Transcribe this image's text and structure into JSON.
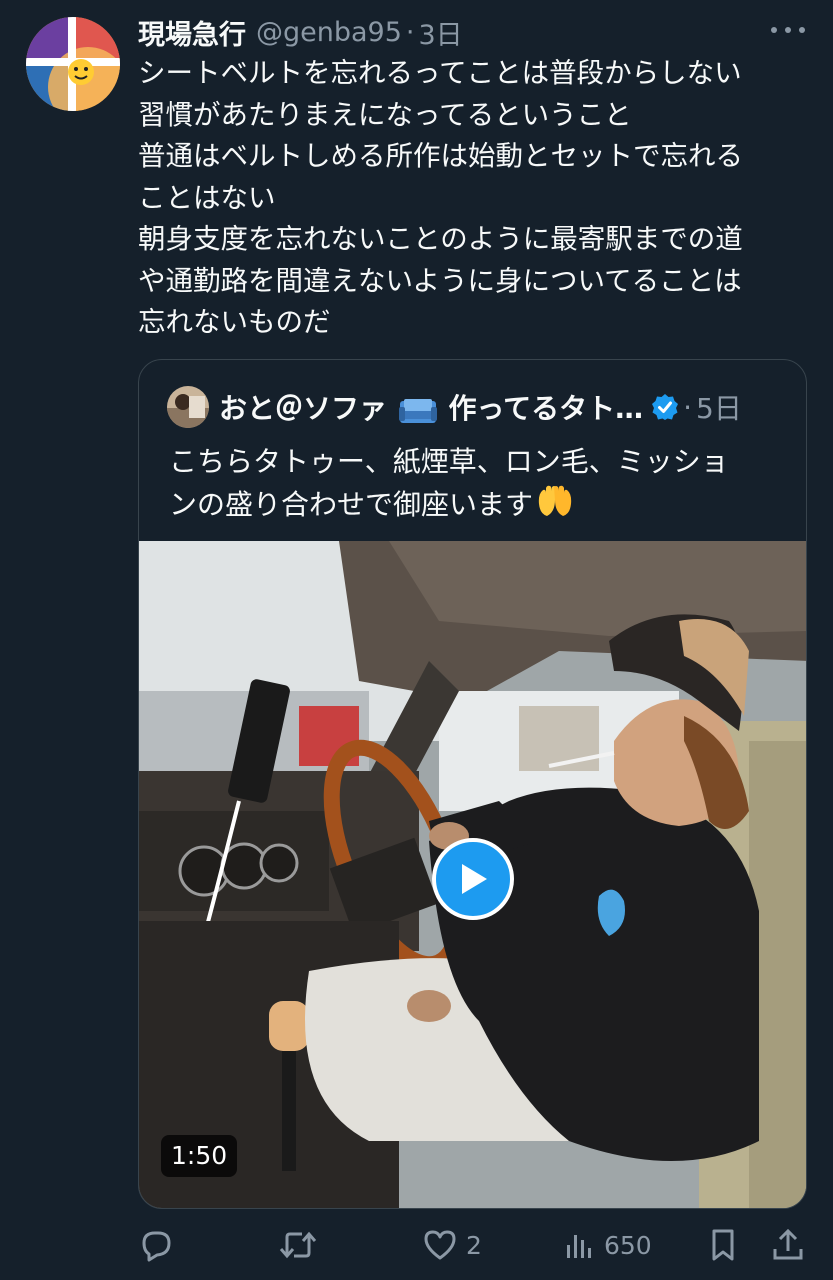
{
  "tweet": {
    "display_name": "現場急行",
    "handle": "@genba95",
    "separator": "·",
    "time": "3日",
    "body_lines": [
      "シートベルトを忘れるってことは普段からしない",
      "習慣があたりまえになってるということ",
      "普通はベルトしめる所作は始動とセットで忘れる",
      "ことはない",
      "朝身支度を忘れないことのように最寄駅までの道",
      "や通勤路を間違えないように身についてることは",
      "忘れないものだ"
    ]
  },
  "quoted": {
    "name_prefix": "おと＠ソファ",
    "name_suffix": "作ってるタト…",
    "separator": "·",
    "time": "5日",
    "text_lines": [
      "こちらタトゥー、紙煙草、ロン毛、ミッショ",
      "ンの盛り合わせで御座います"
    ],
    "video_duration": "1:50"
  },
  "actions": {
    "reply_count": "",
    "retweet_count": "",
    "like_count": "2",
    "views_count": "650"
  },
  "icons": {
    "reply": "reply-icon",
    "retweet": "retweet-icon",
    "like": "heart-icon",
    "views": "views-chart-icon",
    "bookmark": "bookmark-icon",
    "share": "share-icon",
    "more": "more-dots-icon",
    "verified": "verified-badge-icon",
    "play": "play-icon"
  },
  "colors": {
    "background": "#15202b",
    "text": "#f7f9f9",
    "muted": "#8b98a5",
    "accent": "#1d9bf0",
    "border": "#38444d"
  }
}
